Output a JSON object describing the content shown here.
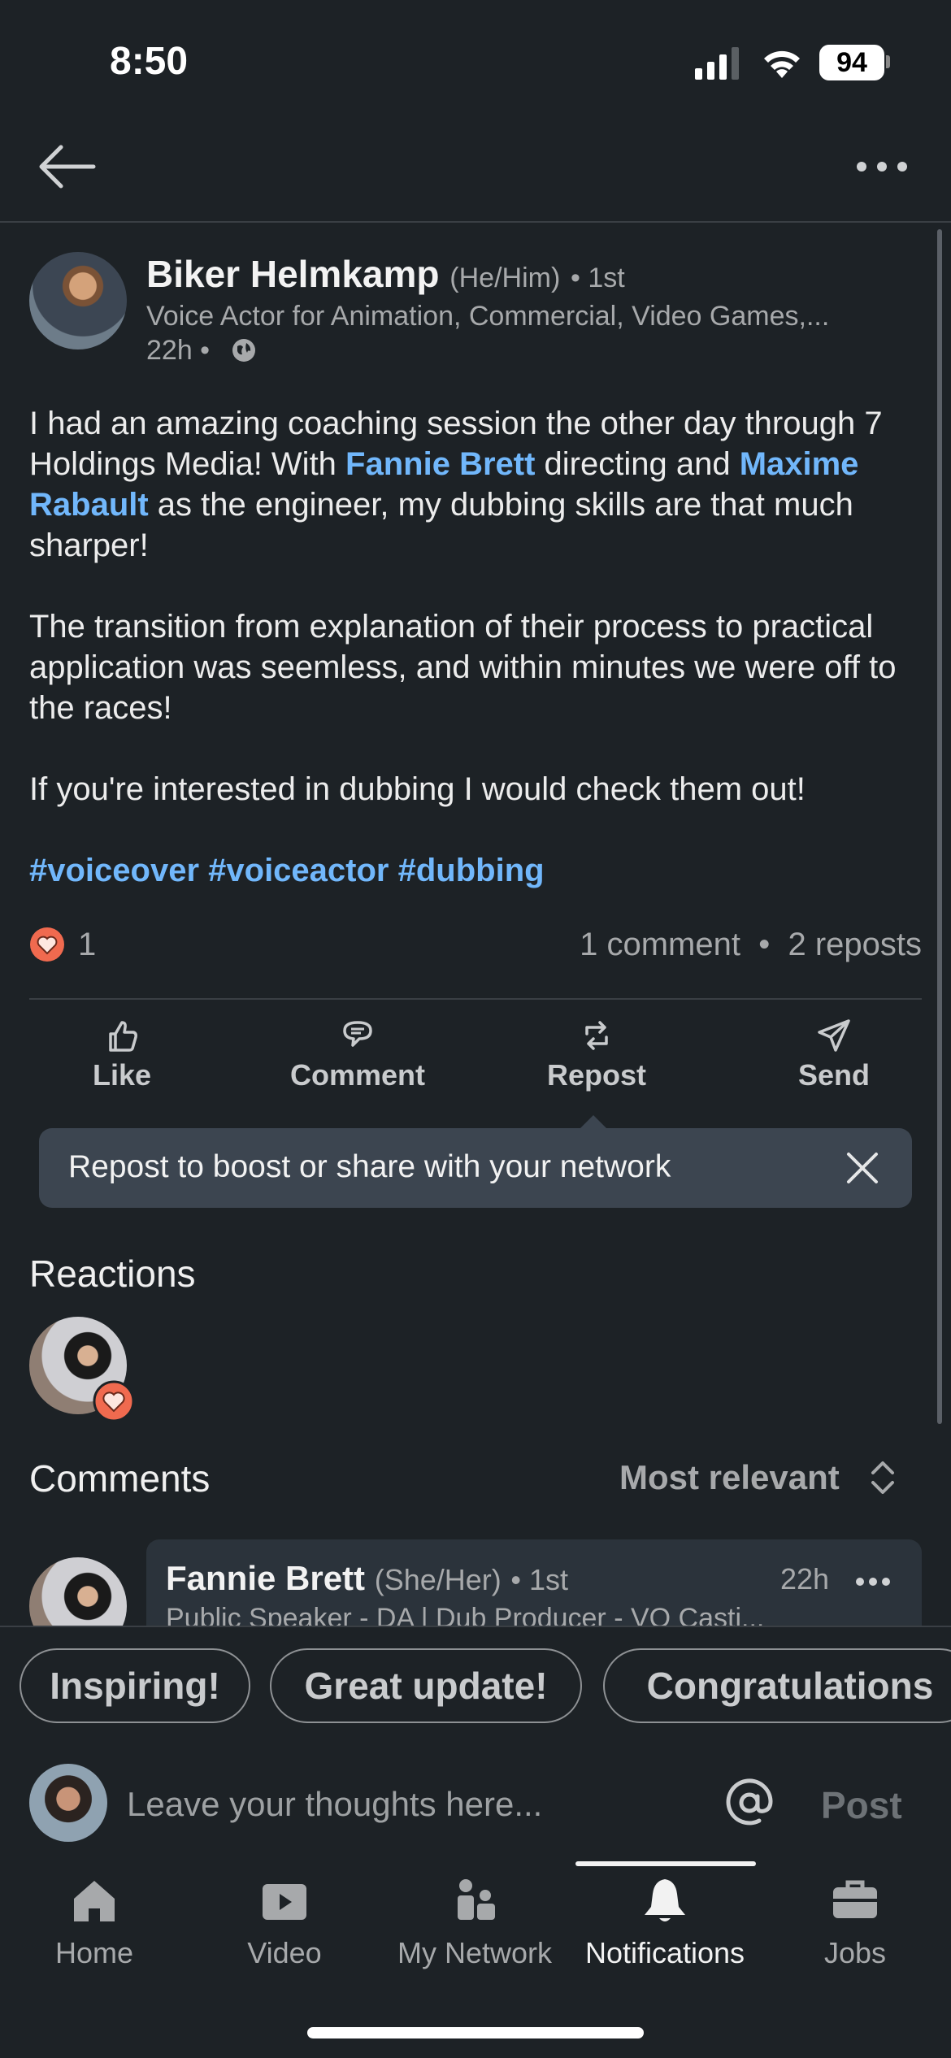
{
  "status_bar": {
    "time": "8:50",
    "battery": "94"
  },
  "post": {
    "author": {
      "name": "Biker Helmkamp",
      "pronouns": "(He/Him)",
      "degree": "• 1st",
      "headline": "Voice Actor for Animation, Commercial, Video Games,...",
      "time": "22h •"
    },
    "body": {
      "p1_a": "I had an amazing coaching session the other day through 7 Holdings Media! With ",
      "mention1": "Fannie Brett",
      "p1_b": " directing and ",
      "mention2": "Maxime Rabault",
      "p1_c": " as the engineer, my dubbing skills are that much sharper!",
      "p2": "The transition from explanation of their process to practical application was seemless, and within minutes we were off to the races!",
      "p3": "If you're interested in dubbing I would check them out!",
      "hashtags": "#voiceover #voiceactor #dubbing"
    },
    "reaction_count": "1",
    "comments_count": "1 comment",
    "reposts_count": "2 reposts",
    "counts_separator": "•"
  },
  "actions": {
    "like": "Like",
    "comment": "Comment",
    "repost": "Repost",
    "send": "Send"
  },
  "tooltip": {
    "text": "Repost to boost or share with your network"
  },
  "reactions": {
    "title": "Reactions"
  },
  "comments": {
    "title": "Comments",
    "sort": "Most relevant",
    "items": [
      {
        "name": "Fannie Brett",
        "pronouns": "(She/Her)",
        "degree": "• 1st",
        "time": "22h",
        "headline": "Public Speaker - DA | Dub Producer - VO Casti..."
      }
    ]
  },
  "quick_replies": [
    "Inspiring!",
    "Great update!",
    "Congratulations"
  ],
  "compose": {
    "placeholder": "Leave your thoughts here...",
    "post_label": "Post"
  },
  "tabs": [
    {
      "label": "Home",
      "icon": "home-icon"
    },
    {
      "label": "Video",
      "icon": "video-icon"
    },
    {
      "label": "My Network",
      "icon": "network-icon"
    },
    {
      "label": "Notifications",
      "icon": "bell-icon",
      "active": true
    },
    {
      "label": "Jobs",
      "icon": "briefcase-icon"
    }
  ],
  "colors": {
    "background": "#1d2226",
    "link": "#71b7fb",
    "heart": "#f06a4f"
  }
}
